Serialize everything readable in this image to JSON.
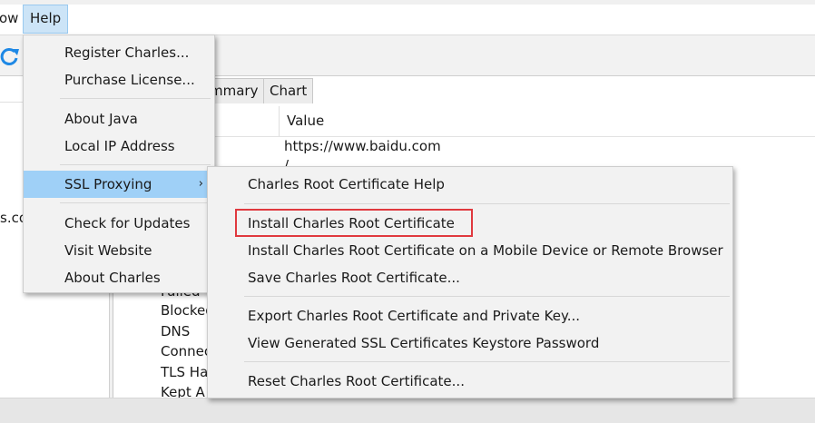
{
  "menubar": {
    "window_partial": "ow",
    "help": "Help"
  },
  "left_pane": {
    "partial_text": "s.co"
  },
  "tabs": {
    "summary_partial": "mmary",
    "chart": "Chart"
  },
  "table": {
    "value_header": "Value",
    "url_value": "https://www.baidu.com",
    "path_value": "/",
    "tree_items": [
      "Failed",
      "Blocked",
      "DNS",
      "Connect",
      "TLS Ha",
      "Kept A"
    ]
  },
  "help_menu": {
    "items": [
      "Register Charles...",
      "Purchase License...",
      "About Java",
      "Local IP Address",
      "SSL Proxying",
      "Check for Updates",
      "Visit Website",
      "About Charles"
    ],
    "submenu_arrow": "›"
  },
  "ssl_menu": {
    "items": [
      "Charles Root Certificate Help",
      "Install Charles Root Certificate",
      "Install Charles Root Certificate on a Mobile Device or Remote Browser",
      "Save Charles Root Certificate...",
      "Export Charles Root Certificate and Private Key...",
      "View Generated SSL Certificates Keystore Password",
      "Reset Charles Root Certificate..."
    ]
  },
  "colors": {
    "menu_hover": "#9fd0f7",
    "highlight_border": "#e0393f",
    "refresh_icon": "#1e88e5"
  }
}
